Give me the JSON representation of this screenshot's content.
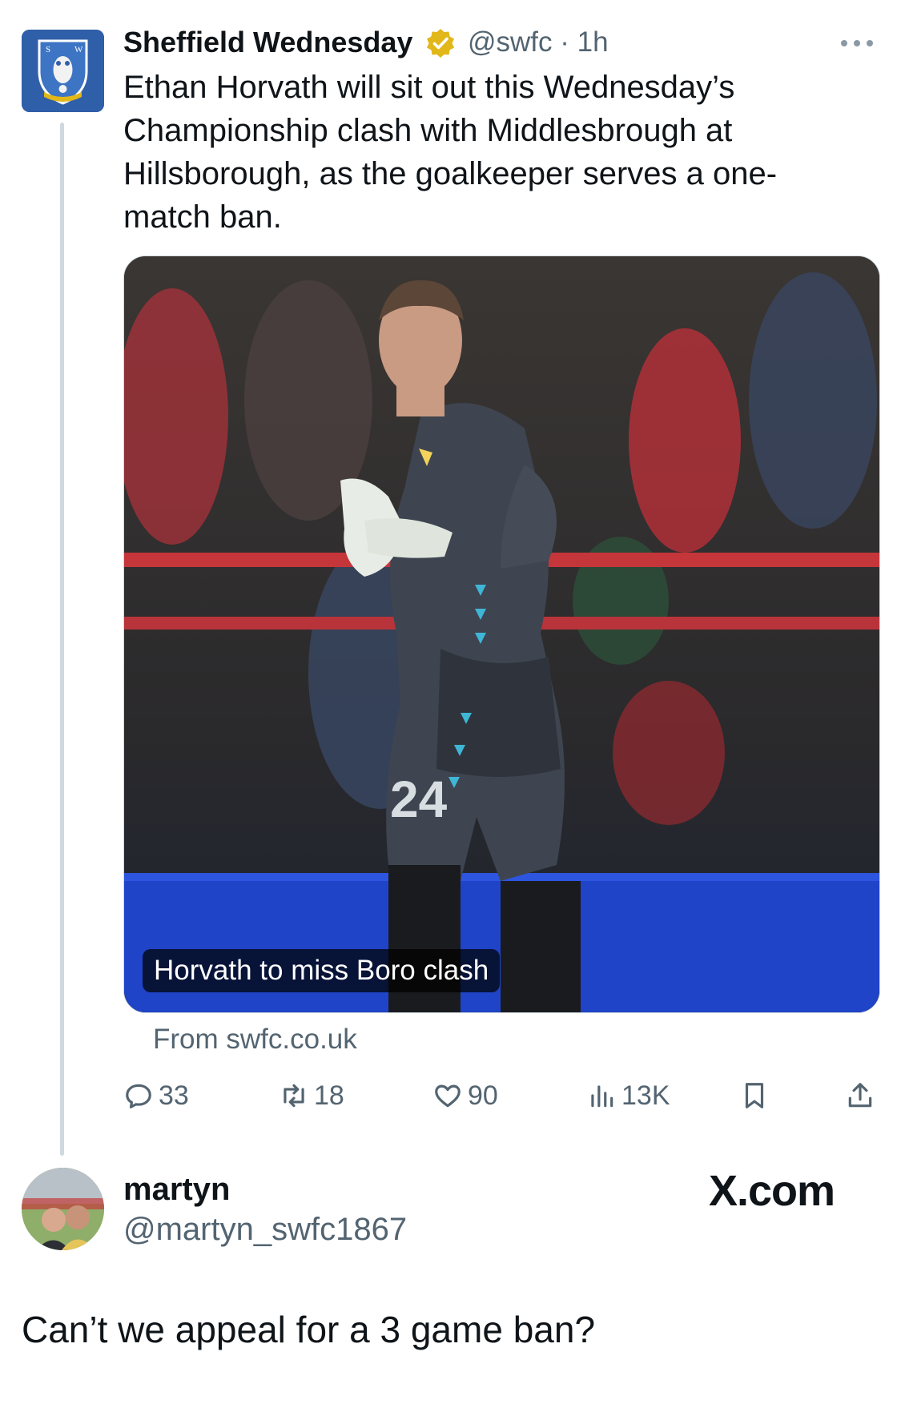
{
  "tweet": {
    "author_name": "Sheffield Wednesday",
    "handle_time": "@swfc · 1h",
    "text": "Ethan Horvath will sit out this Wednesday’s Championship clash with Middlesbrough at Hillsborough, as the goalkeeper serves a one-match ban.",
    "card": {
      "caption": "Horvath to miss Boro clash",
      "source": "From swfc.co.uk"
    },
    "actions": {
      "replies": "33",
      "retweets": "18",
      "likes": "90",
      "views": "13K"
    },
    "icons": {
      "verified": "verified-badge-icon",
      "more": "more-dots-icon",
      "reply": "reply-icon",
      "retweet": "retweet-icon",
      "like": "heart-icon",
      "views": "views-icon",
      "bookmark": "bookmark-icon",
      "share": "share-icon"
    }
  },
  "reply": {
    "name": "martyn",
    "handle": "@martyn_swfc1867",
    "text": "Can’t we appeal for a 3 game ban?"
  },
  "watermark": "X.com",
  "colors": {
    "text": "#0f1419",
    "muted": "#536471",
    "verified_gold": "#e2b719",
    "club_blue": "#2f5fa8"
  }
}
